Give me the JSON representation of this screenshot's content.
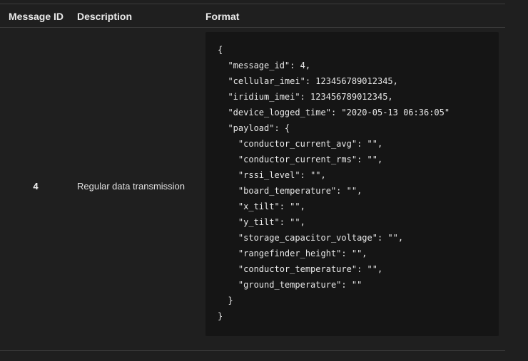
{
  "table": {
    "headers": {
      "message_id": "Message ID",
      "description": "Description",
      "format": "Format"
    },
    "rows": [
      {
        "message_id": "4",
        "description": "Regular data transmission",
        "format_lines": [
          "{",
          "  \"message_id\": 4,",
          "  \"cellular_imei\": 123456789012345,",
          "  \"iridium_imei\": 123456789012345,",
          "  \"device_logged_time\": \"2020-05-13 06:36:05\"",
          "  \"payload\": {",
          "    \"conductor_current_avg\": \"\",",
          "    \"conductor_current_rms\": \"\",",
          "    \"rssi_level\": \"\",",
          "    \"board_temperature\": \"\",",
          "    \"x_tilt\": \"\",",
          "    \"y_tilt\": \"\",",
          "    \"storage_capacitor_voltage\": \"\",",
          "    \"rangefinder_height\": \"\",",
          "    \"conductor_temperature\": \"\",",
          "    \"ground_temperature\": \"\"",
          "  }",
          "}"
        ]
      }
    ]
  }
}
